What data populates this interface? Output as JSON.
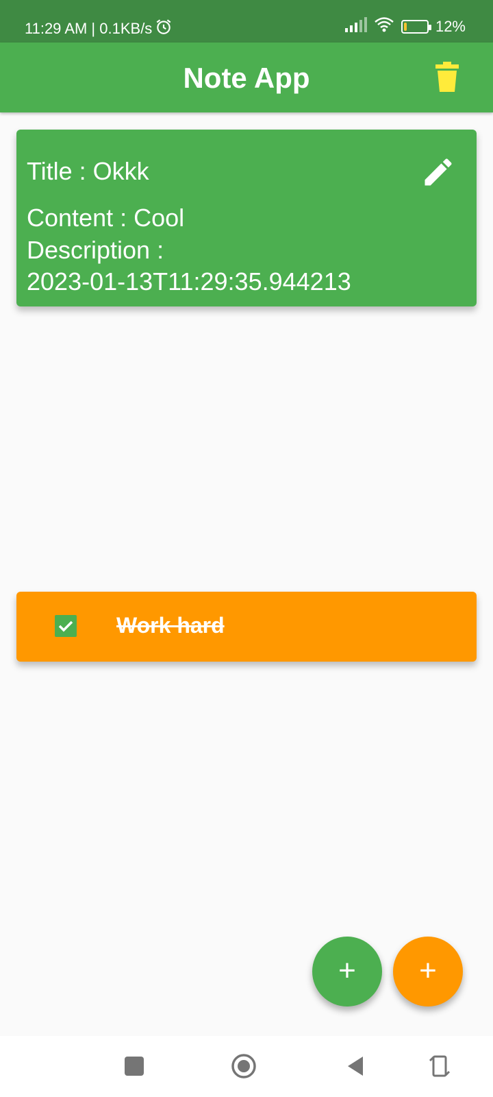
{
  "status_bar": {
    "time_speed": "11:29 AM | 0.1KB/s",
    "battery_percent": "12%",
    "battery_level": 0.12,
    "icons": [
      "alarm-icon",
      "signal-icon",
      "wifi-icon",
      "battery-icon"
    ]
  },
  "app_bar": {
    "title": "Note App",
    "delete_icon": "trash-icon",
    "delete_color": "#ffeb3b"
  },
  "note": {
    "title_line": "Title : Okkk",
    "content_line": "Content : Cool",
    "description_label": "Description :",
    "description_value": "2023-01-13T11:29:35.944213",
    "edit_icon": "pencil-icon",
    "card_color": "#4caf50"
  },
  "todo": {
    "text": "Work hard",
    "checked": true,
    "card_color": "#ff9800"
  },
  "fabs": {
    "add_note_label": "+",
    "add_todo_label": "+",
    "green": "#4caf50",
    "orange": "#ff9800"
  },
  "nav_bar": {
    "icons": [
      "square-icon",
      "home-circle-icon",
      "back-triangle-icon",
      "rotate-icon"
    ]
  }
}
